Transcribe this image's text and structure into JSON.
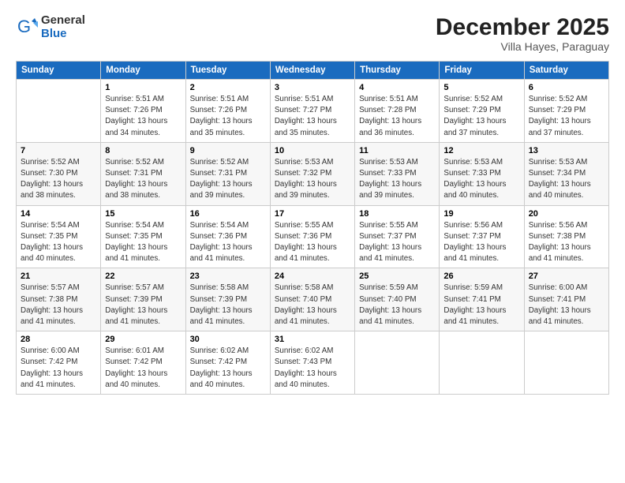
{
  "logo": {
    "general": "General",
    "blue": "Blue"
  },
  "header": {
    "month": "December 2025",
    "location": "Villa Hayes, Paraguay"
  },
  "weekdays": [
    "Sunday",
    "Monday",
    "Tuesday",
    "Wednesday",
    "Thursday",
    "Friday",
    "Saturday"
  ],
  "weeks": [
    [
      {
        "day": "",
        "info": ""
      },
      {
        "day": "1",
        "info": "Sunrise: 5:51 AM\nSunset: 7:26 PM\nDaylight: 13 hours\nand 34 minutes."
      },
      {
        "day": "2",
        "info": "Sunrise: 5:51 AM\nSunset: 7:26 PM\nDaylight: 13 hours\nand 35 minutes."
      },
      {
        "day": "3",
        "info": "Sunrise: 5:51 AM\nSunset: 7:27 PM\nDaylight: 13 hours\nand 35 minutes."
      },
      {
        "day": "4",
        "info": "Sunrise: 5:51 AM\nSunset: 7:28 PM\nDaylight: 13 hours\nand 36 minutes."
      },
      {
        "day": "5",
        "info": "Sunrise: 5:52 AM\nSunset: 7:29 PM\nDaylight: 13 hours\nand 37 minutes."
      },
      {
        "day": "6",
        "info": "Sunrise: 5:52 AM\nSunset: 7:29 PM\nDaylight: 13 hours\nand 37 minutes."
      }
    ],
    [
      {
        "day": "7",
        "info": "Sunrise: 5:52 AM\nSunset: 7:30 PM\nDaylight: 13 hours\nand 38 minutes."
      },
      {
        "day": "8",
        "info": "Sunrise: 5:52 AM\nSunset: 7:31 PM\nDaylight: 13 hours\nand 38 minutes."
      },
      {
        "day": "9",
        "info": "Sunrise: 5:52 AM\nSunset: 7:31 PM\nDaylight: 13 hours\nand 39 minutes."
      },
      {
        "day": "10",
        "info": "Sunrise: 5:53 AM\nSunset: 7:32 PM\nDaylight: 13 hours\nand 39 minutes."
      },
      {
        "day": "11",
        "info": "Sunrise: 5:53 AM\nSunset: 7:33 PM\nDaylight: 13 hours\nand 39 minutes."
      },
      {
        "day": "12",
        "info": "Sunrise: 5:53 AM\nSunset: 7:33 PM\nDaylight: 13 hours\nand 40 minutes."
      },
      {
        "day": "13",
        "info": "Sunrise: 5:53 AM\nSunset: 7:34 PM\nDaylight: 13 hours\nand 40 minutes."
      }
    ],
    [
      {
        "day": "14",
        "info": "Sunrise: 5:54 AM\nSunset: 7:35 PM\nDaylight: 13 hours\nand 40 minutes."
      },
      {
        "day": "15",
        "info": "Sunrise: 5:54 AM\nSunset: 7:35 PM\nDaylight: 13 hours\nand 41 minutes."
      },
      {
        "day": "16",
        "info": "Sunrise: 5:54 AM\nSunset: 7:36 PM\nDaylight: 13 hours\nand 41 minutes."
      },
      {
        "day": "17",
        "info": "Sunrise: 5:55 AM\nSunset: 7:36 PM\nDaylight: 13 hours\nand 41 minutes."
      },
      {
        "day": "18",
        "info": "Sunrise: 5:55 AM\nSunset: 7:37 PM\nDaylight: 13 hours\nand 41 minutes."
      },
      {
        "day": "19",
        "info": "Sunrise: 5:56 AM\nSunset: 7:37 PM\nDaylight: 13 hours\nand 41 minutes."
      },
      {
        "day": "20",
        "info": "Sunrise: 5:56 AM\nSunset: 7:38 PM\nDaylight: 13 hours\nand 41 minutes."
      }
    ],
    [
      {
        "day": "21",
        "info": "Sunrise: 5:57 AM\nSunset: 7:38 PM\nDaylight: 13 hours\nand 41 minutes."
      },
      {
        "day": "22",
        "info": "Sunrise: 5:57 AM\nSunset: 7:39 PM\nDaylight: 13 hours\nand 41 minutes."
      },
      {
        "day": "23",
        "info": "Sunrise: 5:58 AM\nSunset: 7:39 PM\nDaylight: 13 hours\nand 41 minutes."
      },
      {
        "day": "24",
        "info": "Sunrise: 5:58 AM\nSunset: 7:40 PM\nDaylight: 13 hours\nand 41 minutes."
      },
      {
        "day": "25",
        "info": "Sunrise: 5:59 AM\nSunset: 7:40 PM\nDaylight: 13 hours\nand 41 minutes."
      },
      {
        "day": "26",
        "info": "Sunrise: 5:59 AM\nSunset: 7:41 PM\nDaylight: 13 hours\nand 41 minutes."
      },
      {
        "day": "27",
        "info": "Sunrise: 6:00 AM\nSunset: 7:41 PM\nDaylight: 13 hours\nand 41 minutes."
      }
    ],
    [
      {
        "day": "28",
        "info": "Sunrise: 6:00 AM\nSunset: 7:42 PM\nDaylight: 13 hours\nand 41 minutes."
      },
      {
        "day": "29",
        "info": "Sunrise: 6:01 AM\nSunset: 7:42 PM\nDaylight: 13 hours\nand 40 minutes."
      },
      {
        "day": "30",
        "info": "Sunrise: 6:02 AM\nSunset: 7:42 PM\nDaylight: 13 hours\nand 40 minutes."
      },
      {
        "day": "31",
        "info": "Sunrise: 6:02 AM\nSunset: 7:43 PM\nDaylight: 13 hours\nand 40 minutes."
      },
      {
        "day": "",
        "info": ""
      },
      {
        "day": "",
        "info": ""
      },
      {
        "day": "",
        "info": ""
      }
    ]
  ]
}
